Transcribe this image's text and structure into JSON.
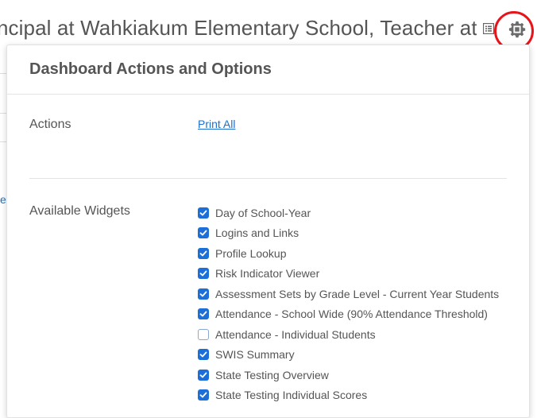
{
  "header": {
    "title": "ncipal at Wahkiakum Elementary School, Teacher at..."
  },
  "background": {
    "link_fragment": "e"
  },
  "panel": {
    "title": "Dashboard Actions and Options",
    "actions_label": "Actions",
    "print_all_label": "Print All",
    "widgets_label": "Available Widgets",
    "widgets": [
      {
        "label": "Day of School-Year",
        "checked": true
      },
      {
        "label": "Logins and Links",
        "checked": true
      },
      {
        "label": "Profile Lookup",
        "checked": true
      },
      {
        "label": "Risk Indicator Viewer",
        "checked": true
      },
      {
        "label": "Assessment Sets by Grade Level - Current Year Students",
        "checked": true
      },
      {
        "label": "Attendance - School Wide (90% Attendance Threshold)",
        "checked": true
      },
      {
        "label": "Attendance - Individual Students",
        "checked": false
      },
      {
        "label": "SWIS Summary",
        "checked": true
      },
      {
        "label": "State Testing Overview",
        "checked": true
      },
      {
        "label": "State Testing Individual Scores",
        "checked": true
      }
    ]
  },
  "colors": {
    "accent": "#1c6fd6",
    "highlight_ring": "#e8141b"
  },
  "icons": [
    "list-icon",
    "gear-icon",
    "checkmark-icon"
  ]
}
